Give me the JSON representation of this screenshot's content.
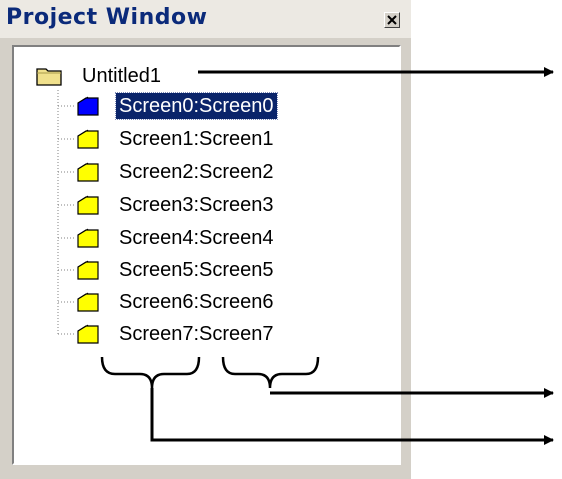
{
  "window": {
    "title": "Project Window",
    "close_glyph": "✕"
  },
  "tree": {
    "root_label": "Untitled1",
    "root_icon": "folder-icon",
    "items": [
      {
        "label": "Screen0:Screen0",
        "selected": true
      },
      {
        "label": "Screen1:Screen1",
        "selected": false
      },
      {
        "label": "Screen2:Screen2",
        "selected": false
      },
      {
        "label": "Screen3:Screen3",
        "selected": false
      },
      {
        "label": "Screen4:Screen4",
        "selected": false
      },
      {
        "label": "Screen5:Screen5",
        "selected": false
      },
      {
        "label": "Screen6:Screen6",
        "selected": false
      },
      {
        "label": "Screen7:Screen7",
        "selected": false
      }
    ]
  },
  "colors": {
    "selection": "#0a246a",
    "screen_icon": "#ffff00",
    "selected_icon": "#0000ff",
    "folder": "#f0e08c",
    "title_text": "#0b2a7a"
  }
}
